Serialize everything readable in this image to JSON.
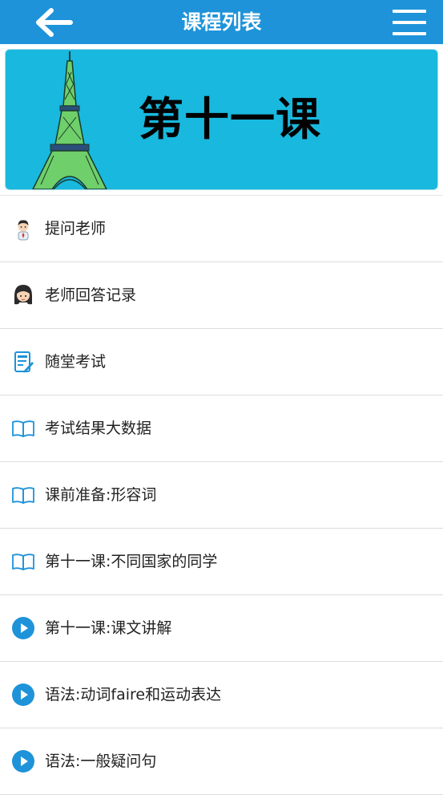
{
  "header": {
    "title": "课程列表",
    "back_icon": "arrow-left-icon",
    "menu_icon": "hamburger-menu-icon",
    "bg_color": "#1e93d9"
  },
  "banner": {
    "title": "第十一课",
    "image": "eiffel-tower-illustration",
    "bg_color": "#19b8de"
  },
  "items": [
    {
      "label": "提问老师",
      "icon": "teacher-avatar-icon"
    },
    {
      "label": "老师回答记录",
      "icon": "girl-avatar-icon"
    },
    {
      "label": "随堂考试",
      "icon": "exam-sheet-icon"
    },
    {
      "label": "考试结果大数据",
      "icon": "open-book-icon"
    },
    {
      "label": "课前准备:形容词",
      "icon": "open-book-icon"
    },
    {
      "label": "第十一课:不同国家的同学",
      "icon": "open-book-icon"
    },
    {
      "label": "第十一课:课文讲解",
      "icon": "play-circle-icon"
    },
    {
      "label": "语法:动词faire和运动表达",
      "icon": "play-circle-icon"
    },
    {
      "label": "语法:一般疑问句",
      "icon": "play-circle-icon"
    }
  ]
}
